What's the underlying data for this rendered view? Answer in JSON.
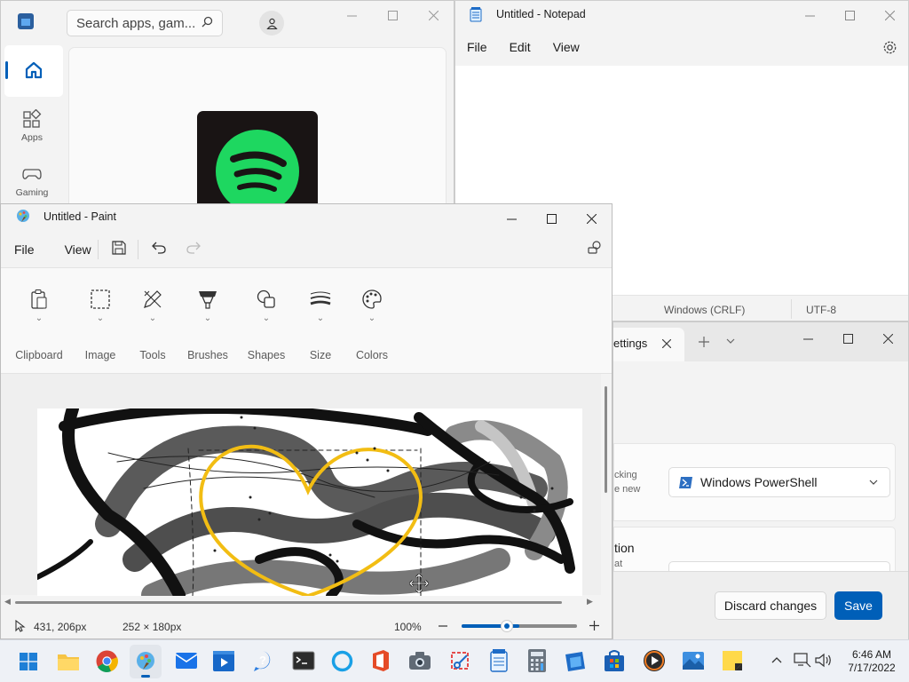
{
  "store": {
    "search_placeholder": "Search apps, gam...",
    "nav": [
      {
        "label": "Home",
        "icon": "home-icon"
      },
      {
        "label": "Apps",
        "icon": "apps-icon"
      },
      {
        "label": "Gaming",
        "icon": "gaming-icon"
      }
    ],
    "colors": {
      "accent": "#005fb8",
      "spotify": "#1ed760"
    }
  },
  "notepad": {
    "title": "Untitled - Notepad",
    "menu": [
      "File",
      "Edit",
      "View"
    ],
    "status": {
      "line_ending": "Windows (CRLF)",
      "encoding": "UTF-8"
    }
  },
  "terminal": {
    "tab_label": "ettings",
    "default_profile": "Windows PowerShell",
    "partial_texts": [
      "cking",
      "e new",
      "tion",
      "at"
    ],
    "discard_label": "Discard changes",
    "save_label": "Save",
    "colors": {
      "accent": "#005fb8"
    }
  },
  "paint": {
    "title": "Untitled - Paint",
    "menu": [
      "File",
      "View"
    ],
    "tools": [
      "Clipboard",
      "Image",
      "Tools",
      "Brushes",
      "Shapes",
      "Size",
      "Colors"
    ],
    "status": {
      "cursor_pos": "431, 206px",
      "selection_size": "252 × 180px",
      "zoom": "100%",
      "zoom_level": 0.5
    },
    "colors": {
      "heart": "#f2bd13"
    }
  },
  "taskbar": {
    "time": "6:46 AM",
    "date": "7/17/2022",
    "apps": [
      "start-icon",
      "file-explorer-icon",
      "chrome-icon",
      "paint-icon",
      "mail-icon",
      "movies-icon",
      "get-help-icon",
      "terminal-icon",
      "cortana-icon",
      "office-icon",
      "camera-icon",
      "snipping-tool-icon",
      "notepad-icon",
      "calculator-icon",
      "store-icon",
      "store-bag-icon",
      "media-player-icon",
      "photos-icon",
      "sticky-notes-icon"
    ]
  }
}
